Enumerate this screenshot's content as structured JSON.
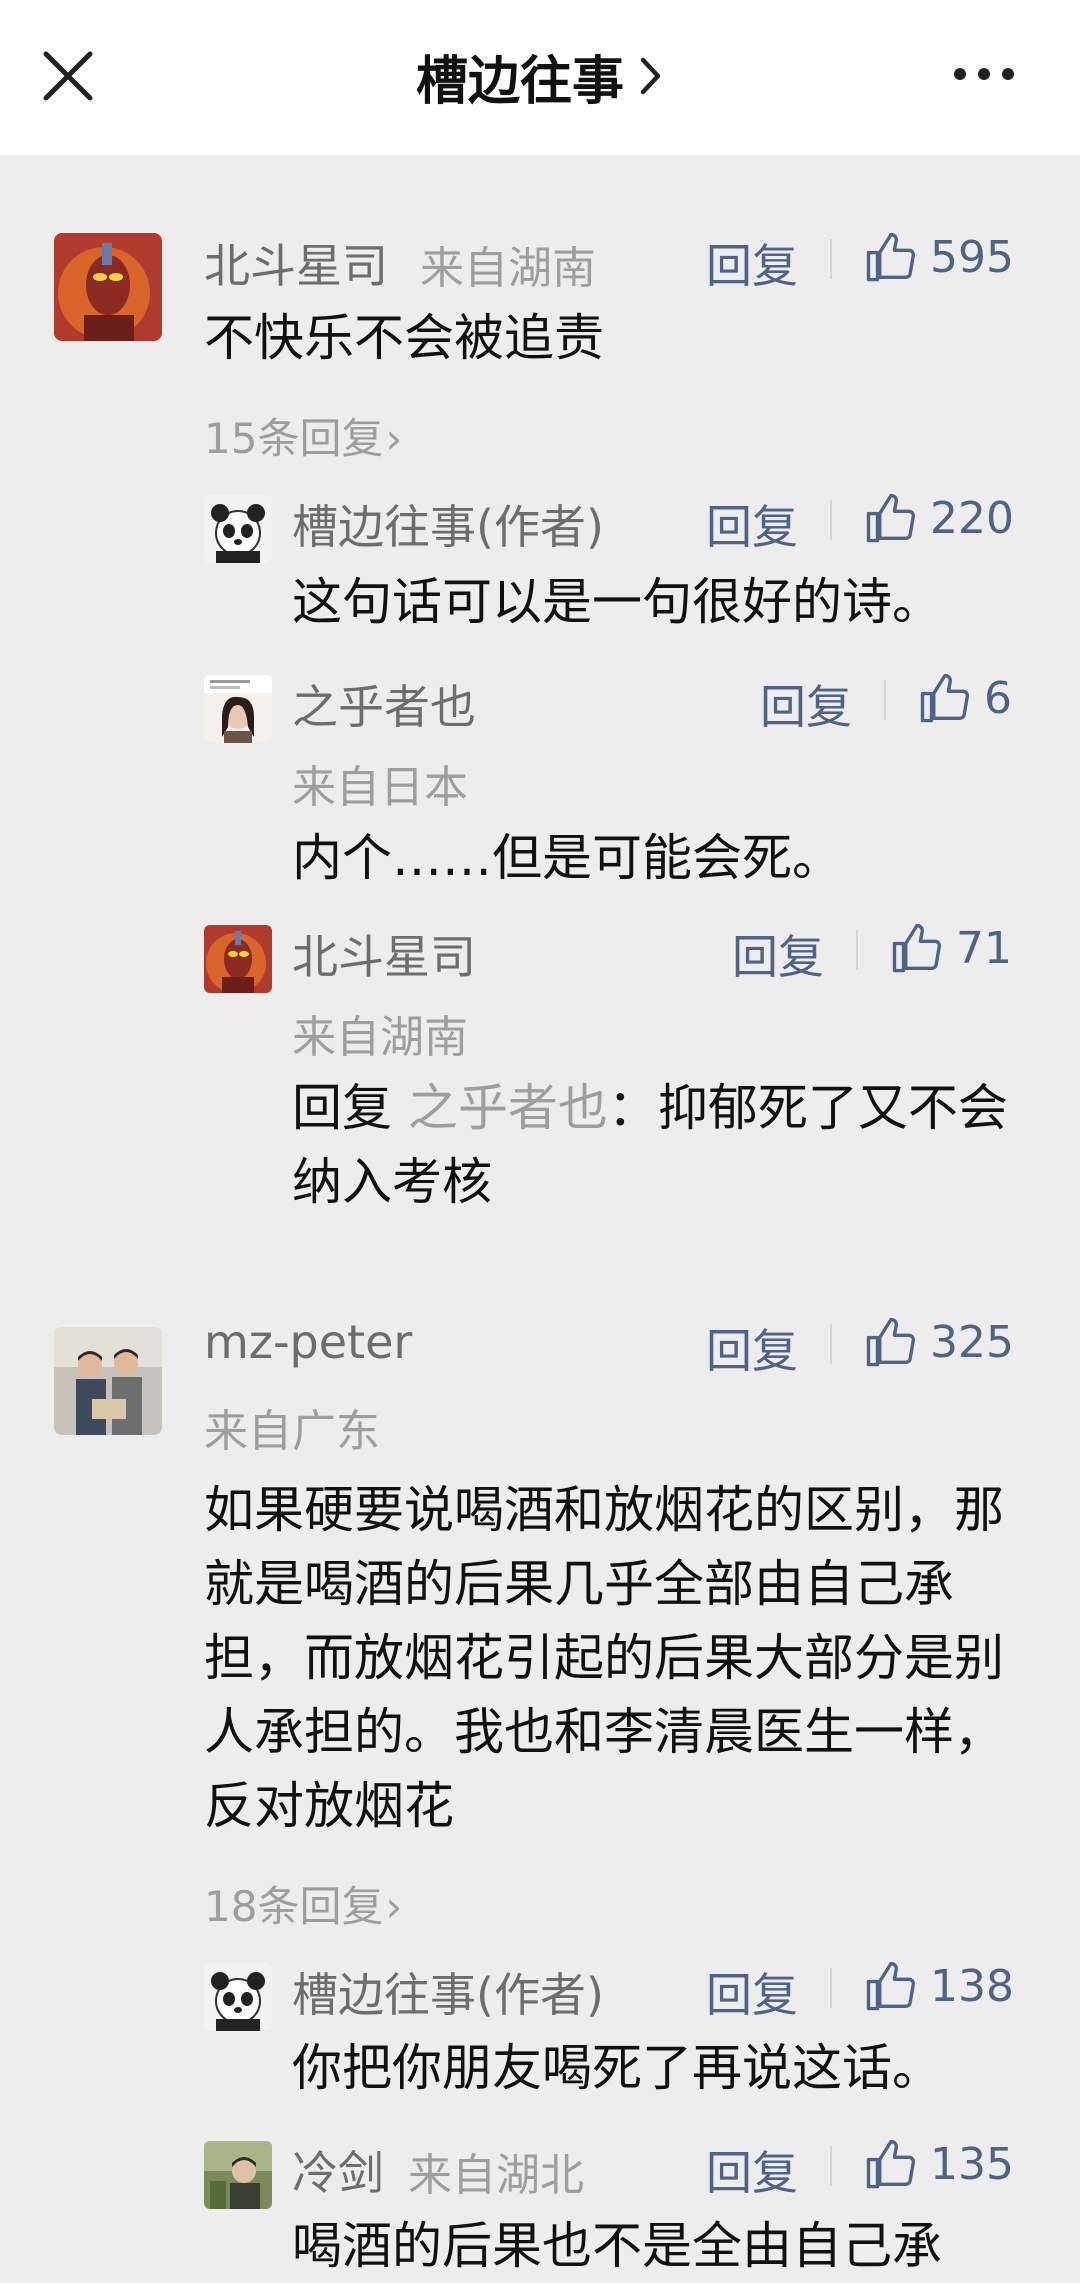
{
  "header": {
    "title": "槽边往事",
    "close_icon": "close-icon",
    "more_icon": "more-dots-icon"
  },
  "colors": {
    "action_blue": "#4f6386",
    "background": "#ededed",
    "muted_text": "#9e9e9e"
  },
  "actions": {
    "reply_label": "回复"
  },
  "comments": [
    {
      "name": "北斗星司",
      "location": "来自湖南",
      "likes": "595",
      "text": "不快乐不会被追责",
      "reply_count": "15条回复",
      "replies": [
        {
          "name": "槽边往事(作者)",
          "likes": "220",
          "text": "这句话可以是一句很好的诗。"
        },
        {
          "name": "之乎者也",
          "location": "来自日本",
          "likes": "6",
          "text": "内个……但是可能会死。"
        },
        {
          "name": "北斗星司",
          "location": "来自湖南",
          "likes": "71",
          "text_prefix": "回复",
          "quote_name": "之乎者也",
          "text": "：抑郁死了又不会纳入考核"
        }
      ]
    },
    {
      "name": "mz-peter",
      "location": "来自广东",
      "likes": "325",
      "text": "如果硬要说喝酒和放烟花的区别，那就是喝酒的后果几乎全部由自己承担，而放烟花引起的后果大部分是别人承担的。我也和李清晨医生一样，反对放烟花",
      "reply_count": "18条回复",
      "replies": [
        {
          "name": "槽边往事(作者)",
          "likes": "138",
          "text": "你把你朋友喝死了再说这话。"
        },
        {
          "name": "冷剑",
          "location": "来自湖北",
          "likes": "135",
          "text": "喝酒的后果也不是全由自己承"
        }
      ]
    }
  ]
}
